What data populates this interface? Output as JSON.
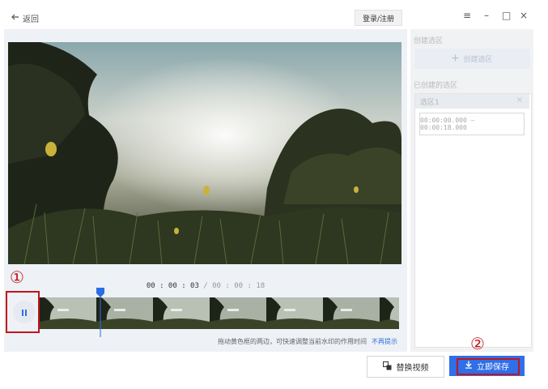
{
  "header": {
    "back_label": "返回",
    "login_label": "登录/注册",
    "menu_icon": "≡",
    "minimize_icon": "–",
    "maximize_icon": "□",
    "close_icon": "×"
  },
  "player": {
    "current_time": "00 : 00 : 03",
    "total_time": " / 00 : 00 : 18",
    "hint_text": "拖动黄色框的两边，可快速调整当前水印的作用时间",
    "hint_link": "不再提示",
    "playhead_fraction": 0.17
  },
  "annotations": {
    "circle_1": "①",
    "circle_2": "②"
  },
  "selection_panel": {
    "create_title": "创建选区",
    "create_button": "创建选区",
    "created_title": "已创建的选区",
    "items": [
      {
        "name": "选区1",
        "range": "00:00:00.000 — 00:00:18.000"
      }
    ]
  },
  "footer": {
    "replace_label": "替换视频",
    "save_label": "立即保存"
  },
  "colors": {
    "accent": "#2f6fe8",
    "annotation_red": "#c0161d",
    "playhead": "#2a6ee8"
  }
}
